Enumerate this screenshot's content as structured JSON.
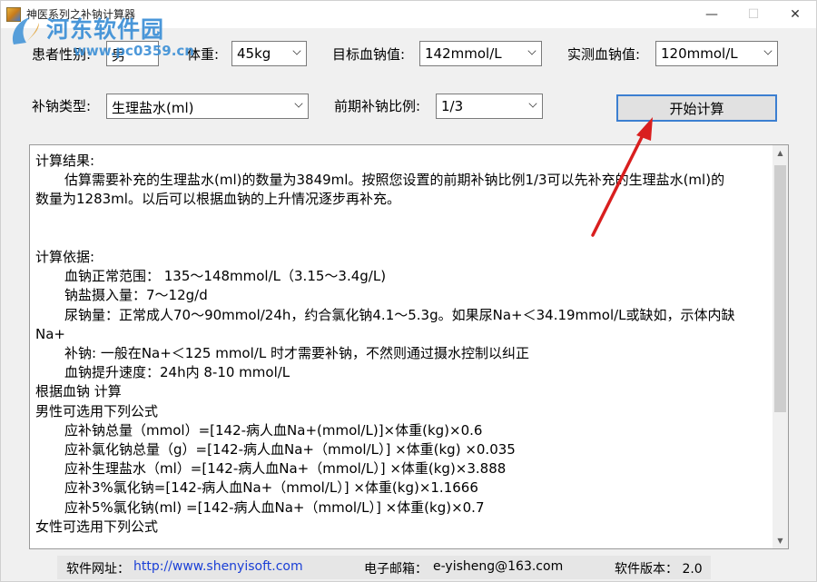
{
  "window": {
    "title": "神医系列之补钠计算器",
    "minimize_icon": "minimize-icon",
    "maximize_icon": "maximize-icon",
    "close_icon": "close-icon"
  },
  "watermark": {
    "site_name": "河东软件园",
    "url": "www.pc0359.cn"
  },
  "form": {
    "gender_label": "患者性别:",
    "gender_value": "男",
    "weight_label": "体重:",
    "weight_value": "45kg",
    "target_na_label": "目标血钠值:",
    "target_na_value": "142mmol/L",
    "measured_na_label": "实测血钠值:",
    "measured_na_value": "120mmol/L",
    "na_type_label": "补钠类型:",
    "na_type_value": "生理盐水(ml)",
    "early_ratio_label": "前期补钠比例:",
    "early_ratio_value": "1/3",
    "calc_button_label": "开始计算"
  },
  "result": {
    "lines": [
      {
        "text": "计算结果:",
        "indent": 0
      },
      {
        "text": "估算需要补充的生理盐水(ml)的数量为3849ml。按照您设置的前期补钠比例1/3可以先补充的生理盐水(ml)的",
        "indent": 1
      },
      {
        "text": "数量为1283ml。以后可以根据血钠的上升情况逐步再补充。",
        "indent": 0
      },
      {
        "text": " ",
        "indent": 0
      },
      {
        "text": " ",
        "indent": 0
      },
      {
        "text": "计算依据:",
        "indent": 0
      },
      {
        "text": "血钠正常范围： 135～148mmol/L（3.15～3.4g/L)",
        "indent": 1
      },
      {
        "text": "钠盐摄入量：7～12g/d",
        "indent": 1
      },
      {
        "text": "尿钠量：正常成人70～90mmol/24h，约合氯化钠4.1～5.3g。如果尿Na+＜34.19mmol/L或缺如，示体内缺",
        "indent": 1
      },
      {
        "text": "Na+",
        "indent": 0
      },
      {
        "text": "补钠: 一般在Na+＜125 mmol/L 时才需要补钠，不然则通过摄水控制以纠正",
        "indent": 1
      },
      {
        "text": "血钠提升速度：24h内 8-10 mmol/L",
        "indent": 1
      },
      {
        "text": "根据血钠 计算",
        "indent": 0
      },
      {
        "text": "男性可选用下列公式",
        "indent": 0
      },
      {
        "text": "应补钠总量（mmol）=[142-病人血Na+(mmol/L)]×体重(kg)×0.6",
        "indent": 1
      },
      {
        "text": "应补氯化钠总量（g）=[142-病人血Na+（mmol/L）] ×体重(kg) ×0.035",
        "indent": 1
      },
      {
        "text": "应补生理盐水（ml）=[142-病人血Na+（mmol/L）] ×体重(kg)×3.888",
        "indent": 1
      },
      {
        "text": "应补3%氯化钠=[142-病人血Na+（mmol/L）] ×体重(kg)×1.1666",
        "indent": 1
      },
      {
        "text": "应补5%氯化钠(ml) =[142-病人血Na+（mmol/L）] ×体重(kg)×0.7",
        "indent": 1
      },
      {
        "text": "女性可选用下列公式",
        "indent": 0
      }
    ]
  },
  "status": {
    "website_label": "软件网址：",
    "website_url": "http://www.shenyisoft.com",
    "email_label": "电子邮箱：",
    "email_value": "e-yisheng@163.com",
    "version_label": "软件版本：",
    "version_value": "2.0"
  },
  "colors": {
    "accent_blue": "#3c7fd1",
    "link_blue": "#1a3fd6",
    "annotation_red": "#d91f1f",
    "watermark_blue": "#3b8fd6"
  }
}
